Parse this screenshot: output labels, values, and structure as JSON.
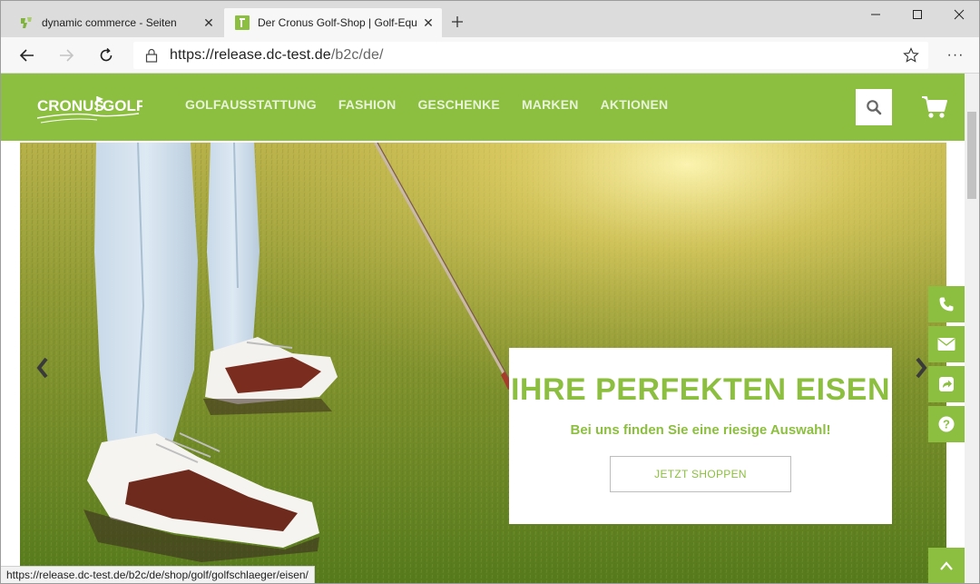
{
  "browser": {
    "tabs": [
      {
        "title": "dynamic commerce - Seiten",
        "active": false,
        "favicon": "dynamic-commerce-favicon"
      },
      {
        "title": "Der Cronus Golf-Shop | Golf-Equ",
        "active": true,
        "favicon": "cronus-favicon"
      }
    ],
    "address": {
      "host": "https://release.dc-test.de",
      "path": "/b2c/de/"
    },
    "status_url": "https://release.dc-test.de/b2c/de/shop/golf/golfschlaeger/eisen/"
  },
  "site": {
    "logo": {
      "text_left": "CRONUS",
      "text_right": "GOLF"
    },
    "nav": [
      {
        "label": "GOLFAUSSTATTUNG"
      },
      {
        "label": "FASHION"
      },
      {
        "label": "GESCHENKE"
      },
      {
        "label": "MARKEN"
      },
      {
        "label": "AKTIONEN"
      }
    ],
    "brand_color": "#8cbf3f"
  },
  "hero": {
    "title": "IHRE PERFEKTEN EISEN",
    "subtitle": "Bei uns finden Sie eine riesige Auswahl!",
    "cta": "JETZT SHOPPEN"
  },
  "side_buttons": [
    "phone-icon",
    "mail-icon",
    "share-icon",
    "help-icon"
  ],
  "icons": {
    "back": "back-arrow-icon",
    "forward": "forward-arrow-icon",
    "refresh": "refresh-icon",
    "lock": "lock-icon",
    "favorite": "star-icon",
    "menu": "more-icon",
    "search": "search-icon",
    "cart": "cart-icon",
    "to_top": "chevron-up-icon"
  }
}
